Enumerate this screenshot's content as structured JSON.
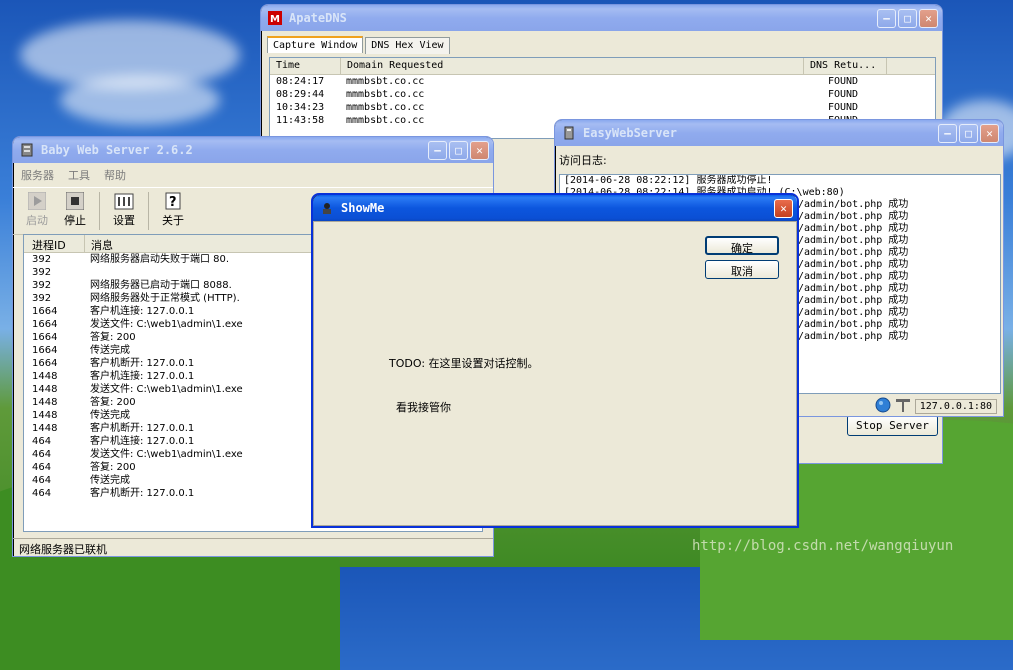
{
  "apatedns": {
    "title": "ApateDNS",
    "tabs": [
      "Capture Window",
      "DNS Hex View"
    ],
    "columns": [
      "Time",
      "Domain Requested",
      "DNS Retu..."
    ],
    "rows": [
      {
        "time": "08:24:17",
        "domain": "mmmbsbt.co.cc",
        "result": "FOUND"
      },
      {
        "time": "08:29:44",
        "domain": "mmmbsbt.co.cc",
        "result": "FOUND"
      },
      {
        "time": "10:34:23",
        "domain": "mmmbsbt.co.cc",
        "result": "FOUND"
      },
      {
        "time": "11:43:58",
        "domain": "mmmbsbt.co.cc",
        "result": "FOUND"
      }
    ],
    "stop_button": "Stop Server"
  },
  "baby": {
    "title": "Baby Web Server 2.6.2",
    "menu": [
      "服务器",
      "工具",
      "帮助"
    ],
    "toolbar": {
      "start": "启动",
      "stop": "停止",
      "settings": "设置",
      "about": "关于"
    },
    "columns": {
      "pid": "进程ID",
      "msg": "消息"
    },
    "log": [
      {
        "pid": "392",
        "msg": "网络服务器启动失败于端口 80."
      },
      {
        "pid": "392",
        "msg": ""
      },
      {
        "pid": "392",
        "msg": "网络服务器已启动于端口 8088."
      },
      {
        "pid": "392",
        "msg": "网络服务器处于正常模式 (HTTP)."
      },
      {
        "pid": "1664",
        "msg": "客户机连接:  127.0.0.1"
      },
      {
        "pid": "1664",
        "msg": "发送文件: C:\\web1\\admin\\1.exe"
      },
      {
        "pid": "1664",
        "msg": "答复: 200"
      },
      {
        "pid": "1664",
        "msg": "传送完成"
      },
      {
        "pid": "1664",
        "msg": "客户机断开:  127.0.0.1"
      },
      {
        "pid": "1448",
        "msg": "客户机连接:  127.0.0.1"
      },
      {
        "pid": "1448",
        "msg": "发送文件: C:\\web1\\admin\\1.exe"
      },
      {
        "pid": "1448",
        "msg": "答复: 200"
      },
      {
        "pid": "1448",
        "msg": "传送完成"
      },
      {
        "pid": "1448",
        "msg": "客户机断开:  127.0.0.1"
      },
      {
        "pid": "464",
        "msg": "客户机连接:  127.0.0.1"
      },
      {
        "pid": "464",
        "msg": "发送文件: C:\\web1\\admin\\1.exe"
      },
      {
        "pid": "464",
        "msg": "答复: 200"
      },
      {
        "pid": "464",
        "msg": "传送完成"
      },
      {
        "pid": "464",
        "msg": "客户机断开:  127.0.0.1"
      }
    ],
    "status": "网络服务器已联机"
  },
  "easy": {
    "title": "EasyWebServer",
    "label": "访问日志:",
    "log": [
      "[2014-06-28 08:22:12] 服务器成功停止!",
      "[2014-06-28 08:22:14] 服务器成功启动! (C:\\web:80)",
      "/admin/bot.php 成功",
      "/admin/bot.php 成功",
      "/admin/bot.php 成功",
      "/admin/bot.php 成功",
      "/admin/bot.php 成功",
      "/admin/bot.php 成功",
      "/admin/bot.php 成功",
      "/admin/bot.php 成功",
      "/admin/bot.php 成功",
      "/admin/bot.php 成功",
      "/admin/bot.php 成功",
      "/admin/bot.php 成功"
    ],
    "status_ip": "127.0.0.1:80"
  },
  "showme": {
    "title": "ShowMe",
    "ok": "确定",
    "cancel": "取消",
    "todo": "TODO: 在这里设置对话控制。",
    "take": "看我接管你"
  },
  "watermark": "http://blog.csdn.net/wangqiuyun"
}
